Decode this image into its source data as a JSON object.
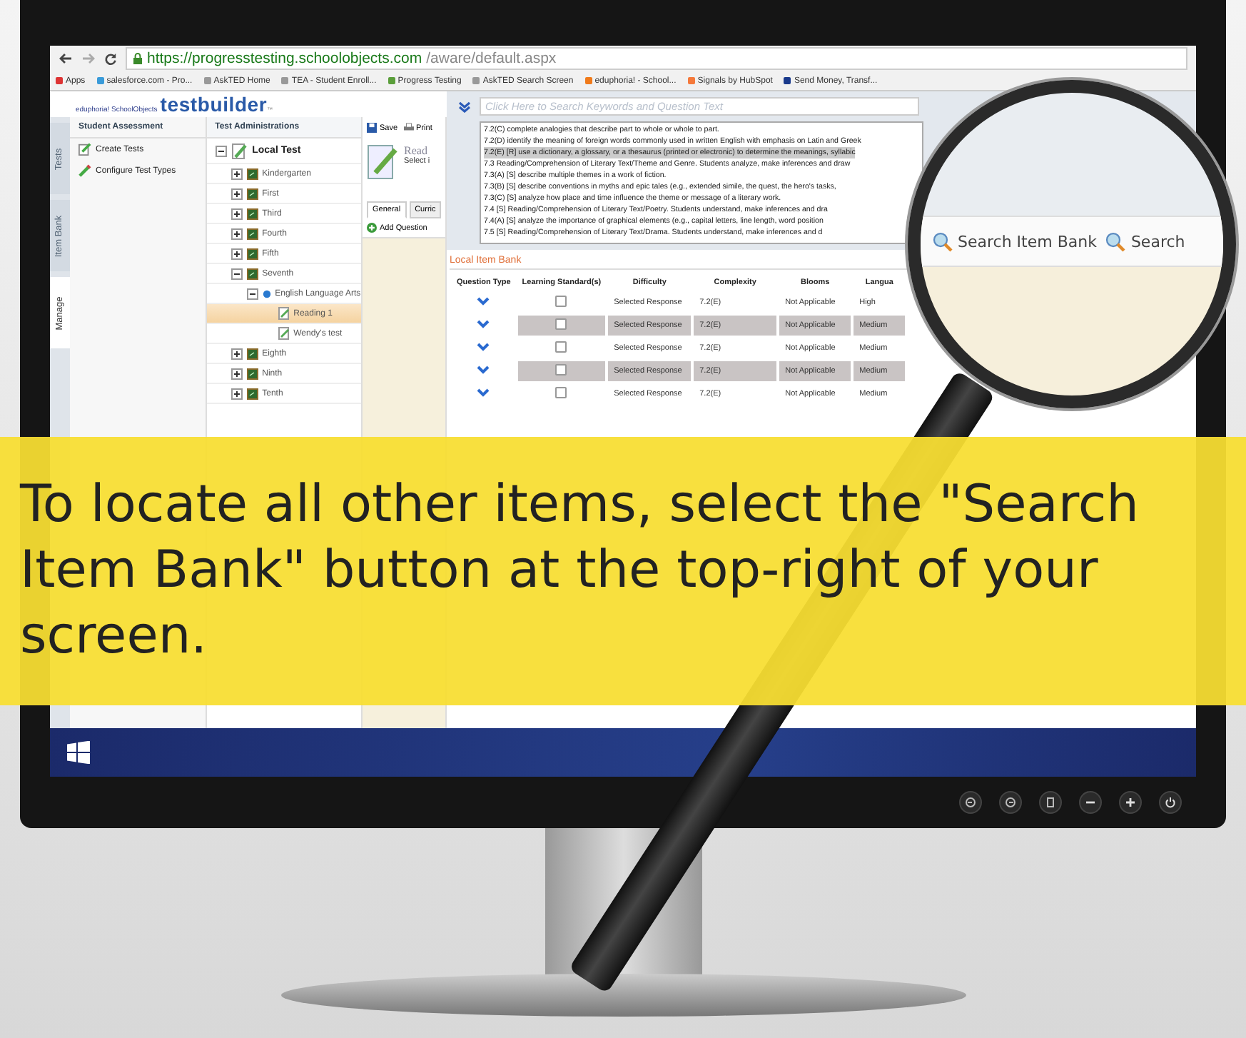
{
  "browser": {
    "url_host": "https://progresstesting.schoolobjects.com",
    "url_path": "/aware/default.aspx",
    "bookmarks": [
      {
        "label": "Apps",
        "kind": "apps"
      },
      {
        "label": "salesforce.com - Pro...",
        "kind": "cloud"
      },
      {
        "label": "AskTED Home",
        "kind": "page"
      },
      {
        "label": "TEA - Student Enroll...",
        "kind": "page"
      },
      {
        "label": "Progress Testing",
        "kind": "globe"
      },
      {
        "label": "AskTED Search Screen",
        "kind": "page"
      },
      {
        "label": "eduphoria! - School...",
        "kind": "orange"
      },
      {
        "label": "Signals by HubSpot",
        "kind": "hubspot"
      },
      {
        "label": "Send Money, Transf...",
        "kind": "paypal"
      }
    ]
  },
  "app": {
    "logo_small": "eduphoria! SchoolObjects",
    "logo": "testbuilder",
    "logo_mark": "™",
    "side_tabs": [
      {
        "label": "Tests",
        "selected": false
      },
      {
        "label": "Item Bank",
        "selected": false
      },
      {
        "label": "Manage",
        "selected": true
      }
    ],
    "sidebar": {
      "title": "Student Assessment",
      "items": [
        {
          "label": "Create Tests",
          "kind": "edit"
        },
        {
          "label": "Configure Test Types",
          "kind": "pencil"
        }
      ]
    },
    "tree": {
      "title": "Test Administrations",
      "items": [
        {
          "label": "Local Test",
          "kind": "local",
          "expanded": true,
          "selected": false,
          "children": [
            {
              "label": "Kindergarten",
              "kind": "grade",
              "expanded": false,
              "selected": false
            },
            {
              "label": "First",
              "kind": "grade",
              "expanded": false,
              "selected": false
            },
            {
              "label": "Third",
              "kind": "grade",
              "expanded": false,
              "selected": false
            },
            {
              "label": "Fourth",
              "kind": "grade",
              "expanded": false,
              "selected": false
            },
            {
              "label": "Fifth",
              "kind": "grade",
              "expanded": false,
              "selected": false
            },
            {
              "label": "Seventh",
              "kind": "grade",
              "expanded": true,
              "selected": false,
              "children": [
                {
                  "label": "English Language Arts",
                  "kind": "subject",
                  "expanded": true,
                  "selected": false,
                  "children": [
                    {
                      "label": "Reading 1",
                      "kind": "test",
                      "selected": true
                    },
                    {
                      "label": "Wendy's test",
                      "kind": "test",
                      "selected": false
                    }
                  ]
                }
              ]
            },
            {
              "label": "Eighth",
              "kind": "grade",
              "expanded": false,
              "selected": false
            },
            {
              "label": "Ninth",
              "kind": "grade",
              "expanded": false,
              "selected": false
            },
            {
              "label": "Tenth",
              "kind": "grade",
              "expanded": false,
              "selected": false
            }
          ]
        }
      ]
    },
    "toolbar": [
      {
        "label": "Save",
        "kind": "save"
      },
      {
        "label": "Print",
        "kind": "print"
      }
    ],
    "test_title": "Read",
    "test_subtitle": "Select i",
    "detail_tabs": [
      {
        "label": "General",
        "selected": true
      },
      {
        "label": "Curric",
        "selected": false
      }
    ],
    "add_question": "Add Question",
    "search": {
      "placeholder": "Click Here to Search Keywords and Question Text"
    },
    "standards": [
      {
        "text": "7.2(C) complete analogies that describe part to whole or whole to part.",
        "selected": false
      },
      {
        "text": "7.2(D) identify the meaning of foreign words commonly used in written English with emphasis on Latin and Greek",
        "selected": false
      },
      {
        "text": "7.2(E) [R] use a dictionary, a glossary, or a thesaurus (printed or electronic) to determine the meanings, syllabic",
        "selected": true
      },
      {
        "text": "7.3 Reading/Comprehension of Literary Text/Theme and Genre. Students analyze, make inferences and draw",
        "selected": false
      },
      {
        "text": "7.3(A) [S] describe multiple themes in a work of fiction.",
        "selected": false
      },
      {
        "text": "7.3(B) [S] describe conventions in myths and epic tales (e.g., extended simile, the quest, the hero's tasks,",
        "selected": false
      },
      {
        "text": "7.3(C) [S] analyze how place and time influence the theme or message of a literary work.",
        "selected": false
      },
      {
        "text": "7.4 [S] Reading/Comprehension of Literary Text/Poetry. Students understand, make inferences and dra",
        "selected": false
      },
      {
        "text": "7.4(A) [S] analyze the importance of graphical elements (e.g., capital letters, line length, word position",
        "selected": false
      },
      {
        "text": "7.5 [S] Reading/Comprehension of Literary Text/Drama. Students understand, make inferences and d",
        "selected": false
      }
    ],
    "item_bank": {
      "title": "Local Item Bank",
      "columns": [
        "Question Type",
        "Learning Standard(s)",
        "Difficulty",
        "Complexity",
        "Blooms",
        "Langua"
      ],
      "rows": [
        {
          "difficulty": "Selected Response",
          "complexity": "7.2(E)",
          "blooms": "Not Applicable",
          "language": "High",
          "checked": false
        },
        {
          "difficulty": "Selected Response",
          "complexity": "7.2(E)",
          "blooms": "Not Applicable",
          "language": "Medium",
          "checked": false
        },
        {
          "difficulty": "Selected Response",
          "complexity": "7.2(E)",
          "blooms": "Not Applicable",
          "language": "Medium",
          "checked": false
        },
        {
          "difficulty": "Selected Response",
          "complexity": "7.2(E)",
          "blooms": "Not Applicable",
          "language": "Medium",
          "checked": false
        },
        {
          "difficulty": "Selected Response",
          "complexity": "7.2(E)",
          "blooms": "Not Applicable",
          "language": "Medium",
          "checked": false
        }
      ]
    }
  },
  "magnifier": {
    "buttons": [
      "Search Item Bank",
      "Search"
    ]
  },
  "banner": {
    "text": "To locate all other items, select the \"Search Item Bank\" button at the top-right of your screen."
  }
}
